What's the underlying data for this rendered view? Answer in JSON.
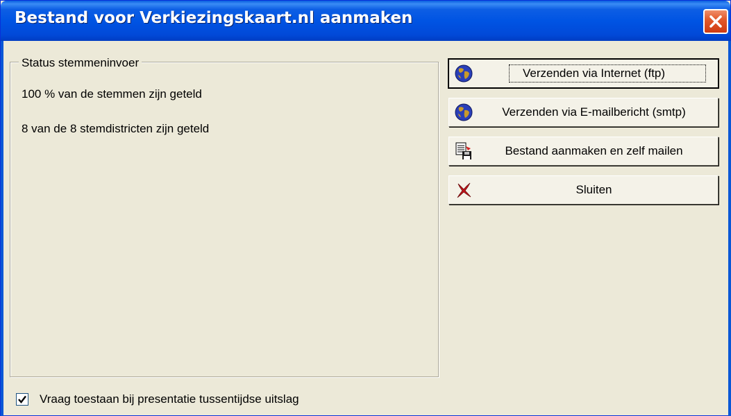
{
  "window": {
    "title": "Bestand voor Verkiezingskaart.nl aanmaken"
  },
  "status": {
    "group_label": "Status stemmeninvoer",
    "votes_counted": "100 % van de stemmen zijn geteld",
    "districts_counted": "8 van de 8 stemdistricten zijn geteld"
  },
  "buttons": {
    "ftp": {
      "label": "Verzenden via Internet (ftp)",
      "icon": "globe-icon"
    },
    "smtp": {
      "label": "Verzenden via E-mailbericht (smtp)",
      "icon": "globe-icon"
    },
    "file": {
      "label": "Bestand aanmaken en zelf mailen",
      "icon": "save-file-icon"
    },
    "close": {
      "label": "Sluiten",
      "icon": "red-x-icon"
    }
  },
  "option": {
    "label": "Vraag toestaan bij presentatie tussentijdse uitslag",
    "checked": true
  },
  "colors": {
    "titlebar": "#0054e3",
    "dialog_bg": "#ece9d8",
    "close_button": "#e35a2c"
  }
}
